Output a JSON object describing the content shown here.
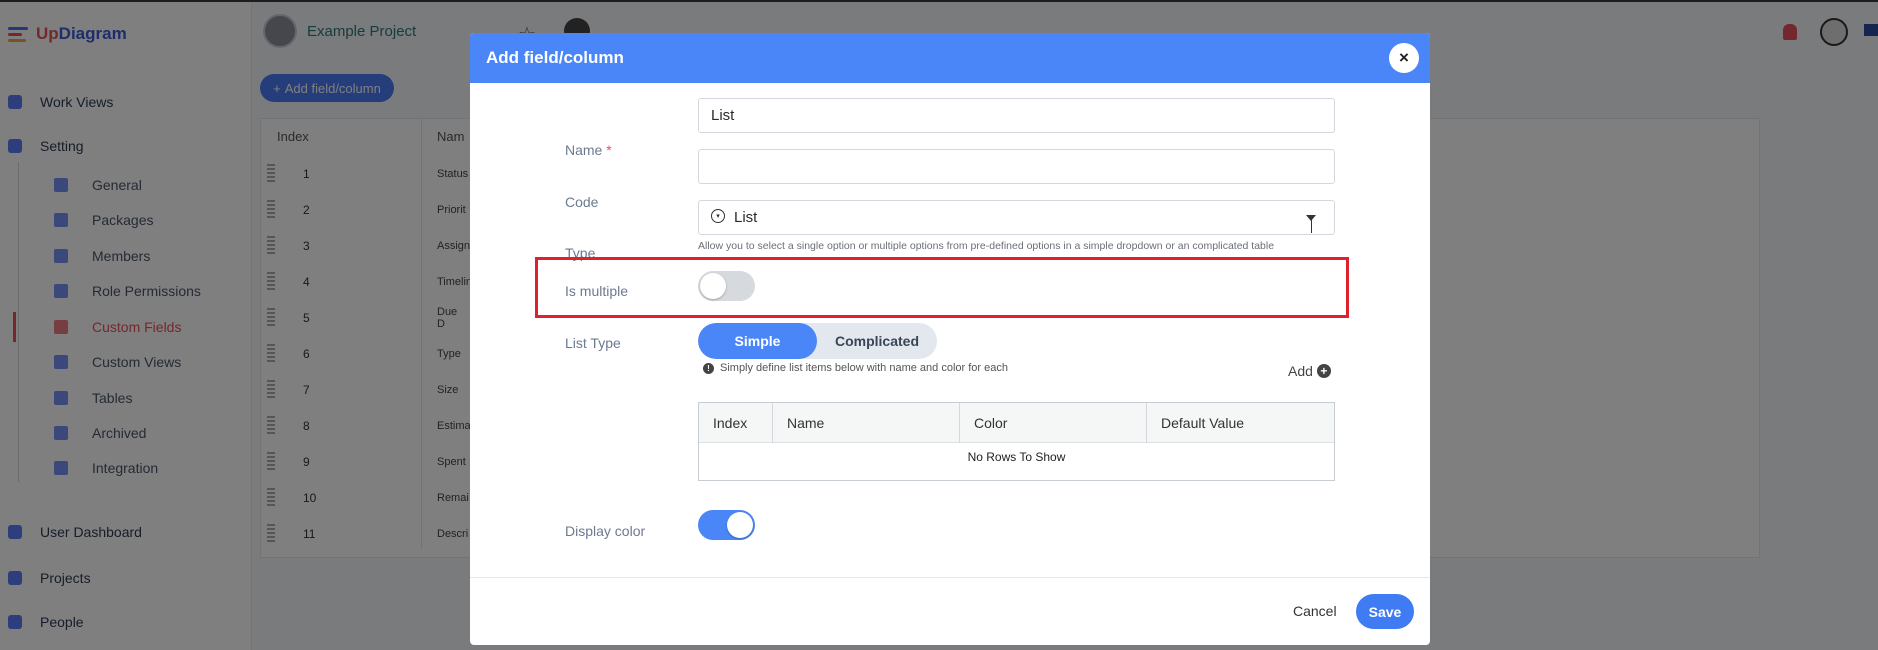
{
  "app": {
    "logo_prefix": "Up",
    "logo_suffix": "Diagram",
    "project_name": "Example Project",
    "add_field_button": "Add field/column",
    "nav": {
      "work_views": "Work Views",
      "setting": "Setting",
      "sub_items": [
        "General",
        "Packages",
        "Members",
        "Role Permissions",
        "Custom Fields",
        "Custom Views",
        "Tables",
        "Archived",
        "Integration"
      ],
      "active_item": "Custom Fields",
      "user_dashboard": "User Dashboard",
      "projects": "Projects",
      "people": "People"
    },
    "table": {
      "header_index": "Index",
      "header_name": "Nam",
      "rows": [
        {
          "index": "1",
          "name": "Status"
        },
        {
          "index": "2",
          "name": "Priorit"
        },
        {
          "index": "3",
          "name": "Assign"
        },
        {
          "index": "4",
          "name": "Timelin"
        },
        {
          "index": "5",
          "name": "Due D"
        },
        {
          "index": "6",
          "name": "Type"
        },
        {
          "index": "7",
          "name": "Size"
        },
        {
          "index": "8",
          "name": "Estima"
        },
        {
          "index": "9",
          "name": "Spent"
        },
        {
          "index": "10",
          "name": "Remai"
        },
        {
          "index": "11",
          "name": "Descri"
        }
      ]
    }
  },
  "modal": {
    "title": "Add field/column",
    "close_symbol": "×",
    "name": {
      "label": "Name",
      "required_mark": "*",
      "value": "List"
    },
    "code": {
      "label": "Code",
      "value": ""
    },
    "type": {
      "label": "Type",
      "value": "List",
      "hint": "Allow you to select a single option or multiple options from pre-defined options in a simple dropdown or an complicated table"
    },
    "is_multiple": {
      "label": "Is multiple",
      "checked": false
    },
    "list_type": {
      "label": "List Type",
      "options": [
        "Simple",
        "Complicated"
      ],
      "selected": "Simple",
      "info": "Simply define list items below with name and color for each",
      "info_icon": "!",
      "add_label": "Add",
      "add_icon": "+"
    },
    "grid": {
      "columns": [
        "Index",
        "Name",
        "Color",
        "Default Value"
      ],
      "empty_text": "No Rows To Show"
    },
    "display_color": {
      "label": "Display color",
      "checked": true
    },
    "footer": {
      "cancel": "Cancel",
      "save": "Save"
    }
  },
  "colors": {
    "header_blue": "#4a86f7",
    "primary_button": "#3f7cf3",
    "highlight_red": "#e0202b",
    "required_red": "#e8505b"
  }
}
